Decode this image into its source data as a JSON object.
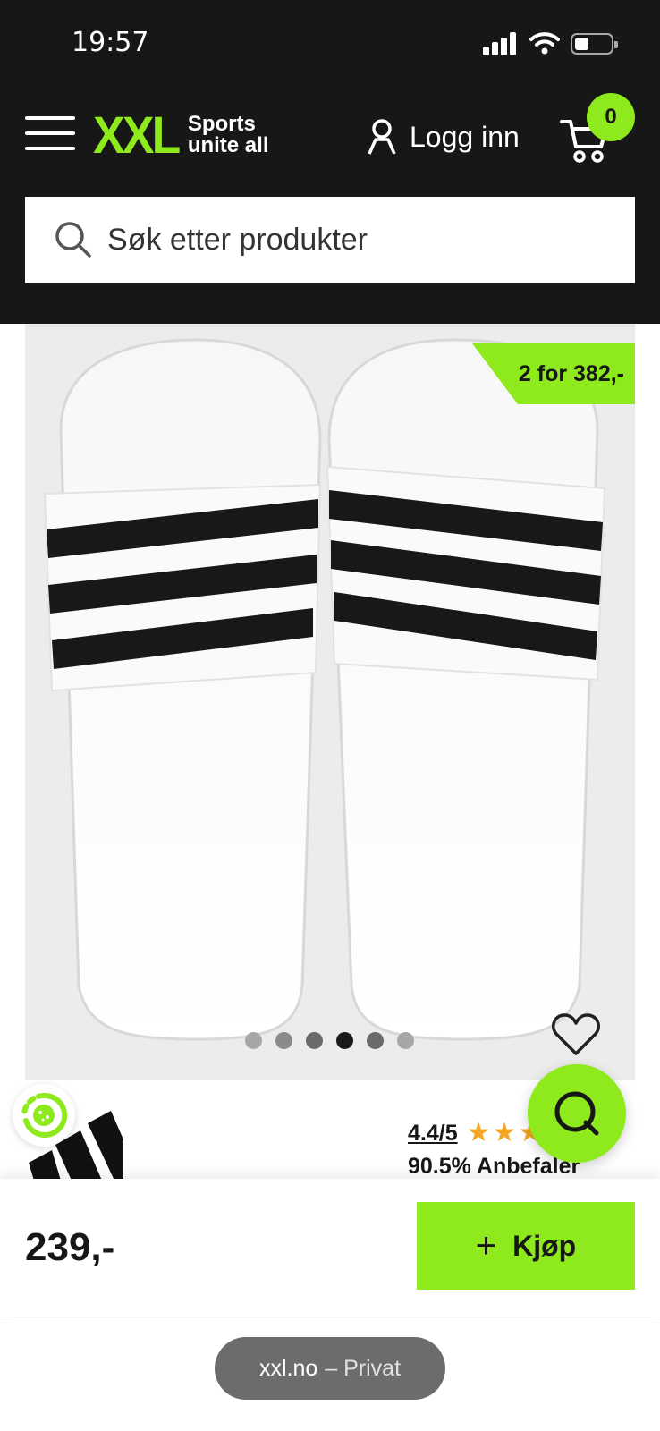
{
  "status_bar": {
    "time": "19:57"
  },
  "header": {
    "logo_text": "XXL",
    "logo_tagline_1": "Sports",
    "logo_tagline_2": "unite all",
    "login_label": "Logg inn",
    "cart_count": "0",
    "brand_color": "#8eea1c",
    "background_color": "#171717"
  },
  "search": {
    "placeholder": "Søk etter produkter"
  },
  "product": {
    "promo_badge": "2 for 382,-",
    "image_dot_count": 6,
    "active_dot_index": 3,
    "rating_score": "4.4/5",
    "rating_value": 4.4,
    "rating_max": 5,
    "recommend_text": "90.5% Anbefaler",
    "price": "239,-",
    "buy_label": "Kjøp"
  },
  "browser": {
    "domain": "xxl.no",
    "mode": "– Privat"
  },
  "icons": [
    "menu-icon",
    "user-icon",
    "cart-icon",
    "search-icon",
    "heart-icon",
    "chat-icon",
    "plus-icon"
  ]
}
